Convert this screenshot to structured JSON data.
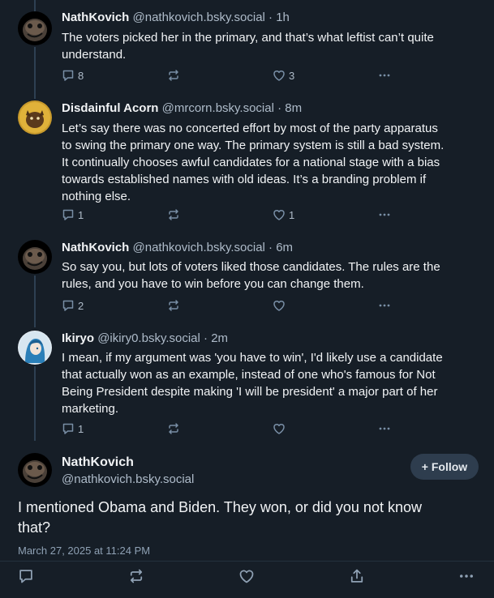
{
  "posts": [
    {
      "author": "NathKovich",
      "handle": "@nathkovich.bsky.social",
      "time": "1h",
      "text_lines": [
        "The voters picked her in the primary, and that’s what leftist can’t quite",
        "understand."
      ],
      "replies": "8",
      "reposts": "",
      "likes": "3",
      "avatar": "nath-avatar"
    },
    {
      "author": "Disdainful Acorn",
      "handle": "@mrcorn.bsky.social",
      "time": "8m",
      "text_lines": [
        "Let’s say there was no concerted effort by most of the party apparatus",
        "to swing the primary one way. The primary system is still a bad system.",
        "It continually chooses awful candidates for a national stage with a bias",
        "towards established names with old ideas. It’s a branding problem if",
        "nothing else."
      ],
      "replies": "1",
      "reposts": "",
      "likes": "1",
      "avatar": "acorn-avatar"
    },
    {
      "author": "NathKovich",
      "handle": "@nathkovich.bsky.social",
      "time": "6m",
      "text_lines": [
        "So say you, but lots of voters liked those candidates. The rules are the",
        "rules, and you have to win before you can change them."
      ],
      "replies": "2",
      "reposts": "",
      "likes": "",
      "avatar": "nath-avatar"
    },
    {
      "author": "Ikiryo",
      "handle": "@ikiry0.bsky.social",
      "time": "2m",
      "text_lines": [
        "I mean, if my argument was 'you have to win', I'd likely use a candidate",
        "that actually won as an example, instead of one who's famous for Not",
        "Being President despite making 'I will be president' a major part of her",
        "marketing."
      ],
      "replies": "1",
      "reposts": "",
      "likes": "",
      "avatar": "ikiryo-avatar"
    }
  ],
  "separator": "·",
  "main_post": {
    "author": "NathKovich",
    "handle": "@nathkovich.bsky.social",
    "follow_label": "+ Follow",
    "text_lines": [
      "I mentioned Obama and Biden. They won, or did you not know",
      "that?"
    ],
    "date": "March 27, 2025 at 11:24 PM"
  },
  "icons": {
    "reply": "reply-icon",
    "repost": "repost-icon",
    "like": "heart-icon",
    "share": "share-icon",
    "more": "more-icon"
  },
  "colors": {
    "background": "#161e27",
    "text": "#f1f3f5",
    "muted": "#aebbc9",
    "icon": "#788ea5",
    "follow_bg": "#2e3d4e"
  }
}
